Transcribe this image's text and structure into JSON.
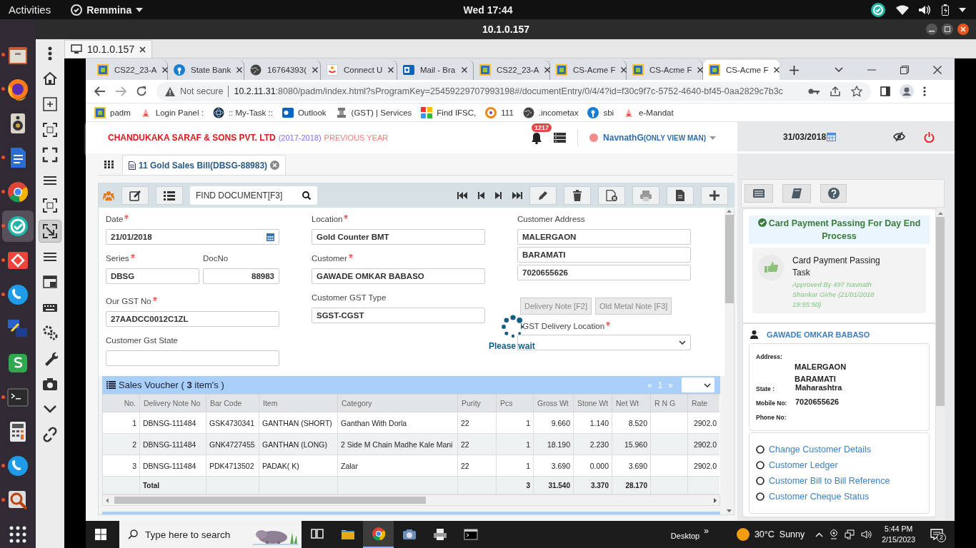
{
  "system_bar": {
    "activities": "Activities",
    "app_menu": "Remmina",
    "clock": "Wed 17:44"
  },
  "dock": [
    {
      "kind": "files",
      "running": true,
      "selected": false
    },
    {
      "kind": "firefox",
      "running": true,
      "selected": false
    },
    {
      "kind": "speaker",
      "running": false,
      "selected": false
    },
    {
      "kind": "writer",
      "running": true,
      "selected": false
    },
    {
      "kind": "chrome",
      "running": true,
      "selected": false
    },
    {
      "kind": "remmina",
      "running": true,
      "selected": true
    },
    {
      "kind": "anydesk",
      "running": true,
      "selected": false
    },
    {
      "kind": "phone",
      "running": true,
      "selected": false
    },
    {
      "kind": "network",
      "running": false,
      "selected": false
    },
    {
      "kind": "sheet",
      "running": false,
      "selected": false
    },
    {
      "kind": "terminal",
      "running": true,
      "selected": false
    },
    {
      "kind": "calculator",
      "running": false,
      "selected": false
    },
    {
      "kind": "phone",
      "running": true,
      "selected": false
    },
    {
      "kind": "viewer",
      "running": true,
      "selected": false
    },
    {
      "kind": "apps",
      "running": false,
      "selected": false
    }
  ],
  "remmina": {
    "title": "10.1.0.157",
    "tabs": [
      {
        "label": "10.1.0.157",
        "selected": true
      }
    ],
    "tools": [
      {
        "kind": "menu-dots",
        "selected": false
      },
      {
        "kind": "home",
        "selected": false
      },
      {
        "kind": "new-window",
        "selected": false
      },
      {
        "kind": "fit",
        "selected": false
      },
      {
        "kind": "fullscreen",
        "selected": false
      },
      {
        "kind": "lines",
        "selected": false
      },
      {
        "kind": "fit",
        "selected": false
      },
      {
        "kind": "scale",
        "selected": true
      },
      {
        "kind": "lines",
        "selected": false
      },
      {
        "kind": "multi-window",
        "selected": false
      },
      {
        "kind": "keyboard",
        "selected": false
      },
      {
        "kind": "gears",
        "selected": false
      },
      {
        "kind": "wrench",
        "selected": false
      },
      {
        "kind": "camera",
        "selected": false
      },
      {
        "kind": "chevron",
        "selected": false
      },
      {
        "kind": "disconnect",
        "selected": false
      }
    ]
  },
  "browser": {
    "tabs": [
      {
        "label": "CS22_23-A",
        "kind": "app",
        "selected": false
      },
      {
        "label": "State Bank",
        "kind": "bank",
        "selected": false
      },
      {
        "label": "16764393(",
        "kind": "globe",
        "selected": false
      },
      {
        "label": "Connect U",
        "kind": "connect",
        "selected": false
      },
      {
        "label": "Mail - Bra",
        "kind": "mail",
        "selected": false
      },
      {
        "label": "CS22_23-A",
        "kind": "app",
        "selected": false
      },
      {
        "label": "CS-Acme F",
        "kind": "app",
        "selected": false
      },
      {
        "label": "CS-Acme F",
        "kind": "app",
        "selected": false
      },
      {
        "label": "CS-Acme F",
        "kind": "app",
        "selected": true
      }
    ],
    "address": {
      "security": "Not secure",
      "host": "10.2.11.31",
      "path": ":8080/padm/index.html?sProgramKey=25459229707993198#/documentEntry/0/4/4?id=f30c9f7c-5752-4640-bf45-0aa2829c7b3c"
    },
    "bookmarks": [
      {
        "label": "padm",
        "kind": "app"
      },
      {
        "label": "Login Panel :",
        "kind": "login"
      },
      {
        "label": ":: My-Task ::",
        "kind": "atom"
      },
      {
        "label": "Outlook",
        "kind": "outlook"
      },
      {
        "label": "(GST) | Services",
        "kind": "emblem"
      },
      {
        "label": "Find IFSC,",
        "kind": "ifsc"
      },
      {
        "label": "111",
        "kind": "ring"
      },
      {
        "label": ".incometax",
        "kind": "globe"
      },
      {
        "label": "sbi",
        "kind": "bank"
      },
      {
        "label": "e-Mandat",
        "kind": "login"
      }
    ]
  },
  "app": {
    "company": "CHANDUKAKA SARAF & SONS PVT. LTD",
    "year": "(2017-2018)",
    "year_note": "PREVIOUS YEAR",
    "notifications": "1217",
    "user": "NavnathG",
    "role": "(ONLY VIEW MAN)",
    "date": "31/03/2018",
    "document_tab": "11 Gold Sales Bill(DBSG-88983)",
    "search": {
      "placeholder": "FIND DOCUMENT[F3]"
    },
    "form": {
      "columns": [
        [
          {
            "kind": "date",
            "label": "Date",
            "required": true,
            "value": "21/01/2018"
          },
          {
            "kind": "pair",
            "fields": [
              {
                "label": "Series",
                "required": true,
                "value": "DBSG"
              },
              {
                "label": "DocNo",
                "required": false,
                "value": "88983"
              }
            ]
          },
          {
            "kind": "field",
            "label": "Our GST No",
            "required": true,
            "value": "27AADCC0012C1ZL"
          },
          {
            "kind": "field",
            "label": "Customer Gst State",
            "required": false
          }
        ],
        [
          {
            "kind": "field",
            "label": "Location",
            "required": true,
            "value": "Gold Counter BMT"
          },
          {
            "kind": "field",
            "label": "Customer",
            "required": true,
            "value": "GAWADE OMKAR BABASO"
          },
          {
            "kind": "field",
            "label": "Customer GST Type",
            "required": false,
            "value": "SGST-CGST"
          }
        ],
        [
          {
            "kind": "stack",
            "label": "Customer Address",
            "values": [
              "MALERGAON",
              "BARAMATI",
              "7020655626"
            ]
          },
          {
            "kind": "buttons",
            "buttons": [
              {
                "label": "Delivery Note [F2]",
                "disabled": true
              },
              {
                "label": "Old Metal Note [F3]",
                "disabled": true
              }
            ]
          },
          {
            "kind": "select",
            "label": "IGST Delivery Location",
            "required": true
          }
        ]
      ],
      "loading": "Please wait"
    },
    "voucher": {
      "title": "Sales Voucher ( **3** item's )",
      "pager": {
        "prev": "«",
        "page": "1",
        "next": "»"
      },
      "columns": [
        "No.",
        "Delivery Note No",
        "Bar Code",
        "Item",
        "Category",
        "Purity",
        "Pcs",
        "Gross Wt",
        "Stone Wt",
        "Net Wt",
        "R N G",
        "Rate"
      ],
      "rows": [
        {
          "no": "1",
          "delivery_note_no": "DBNSG-111484",
          "bar_code": "GSK4730341",
          "item": "GANTHAN (SHORT)",
          "category": "Ganthan With Dorla",
          "purity": "22",
          "pcs": "1",
          "gross_wt": "9.660",
          "stone_wt": "1.140",
          "net_wt": "8.520",
          "rate": "2902.0"
        },
        {
          "no": "2",
          "delivery_note_no": "DBNSG-111484",
          "bar_code": "GNK4727455",
          "item": "GANTHAN (LONG)",
          "category": "2 Side M Chain Madhe Kale Mani",
          "purity": "22",
          "pcs": "1",
          "gross_wt": "18.190",
          "stone_wt": "2.230",
          "net_wt": "15.960",
          "rate": "2902.0"
        },
        {
          "no": "3",
          "delivery_note_no": "DBNSG-111484",
          "bar_code": "PDK4713502",
          "item": "PADAK( K)",
          "category": "Zalar",
          "purity": "22",
          "pcs": "1",
          "gross_wt": "3.690",
          "stone_wt": "0.000",
          "net_wt": "3.690",
          "rate": "2902.0"
        }
      ],
      "total": {
        "delivery_note_no": "Total",
        "pcs": "3",
        "gross_wt": "31.540",
        "stone_wt": "3.370",
        "net_wt": "28.170"
      }
    },
    "task": {
      "title": "Card Payment Passing For Day End Process",
      "name": "Card Payment Passing Task",
      "approval": "Approved By 497 Navnath Shankar Girhe (21/01/2018 19:55:50)"
    },
    "customer": {
      "name": "GAWADE OMKAR BABASO",
      "details": [
        {
          "label": "Address:",
          "values": [
            "MALERGAON",
            "BARAMATI"
          ]
        },
        {
          "label": "State :",
          "values": [
            "Maharashtra"
          ]
        },
        {
          "label": "Mobile No:",
          "values": [
            "7020655626"
          ]
        },
        {
          "label": "Phone No:"
        }
      ],
      "links": [
        {
          "label": "Change Customer Details",
          "selected": false
        },
        {
          "label": "Customer Ledger",
          "selected": false
        },
        {
          "label": "Customer Bill to Bill Reference",
          "selected": false
        },
        {
          "label": "Customer Cheque Status",
          "selected": false
        }
      ]
    }
  },
  "taskbar": {
    "search_placeholder": "Type here to search",
    "apps": [
      {
        "kind": "task-view",
        "selected": false
      },
      {
        "kind": "folder",
        "selected": false
      },
      {
        "kind": "chrome",
        "selected": true
      },
      {
        "kind": "camera",
        "selected": false
      },
      {
        "kind": "printer",
        "selected": false
      },
      {
        "kind": "terminal",
        "selected": false
      }
    ],
    "toolbar": "Desktop",
    "toolbar_more": "»",
    "temperature": "30°C",
    "weather": "Sunny",
    "time": "5:44 PM",
    "date": "2/15/2023",
    "notifications": "2"
  }
}
